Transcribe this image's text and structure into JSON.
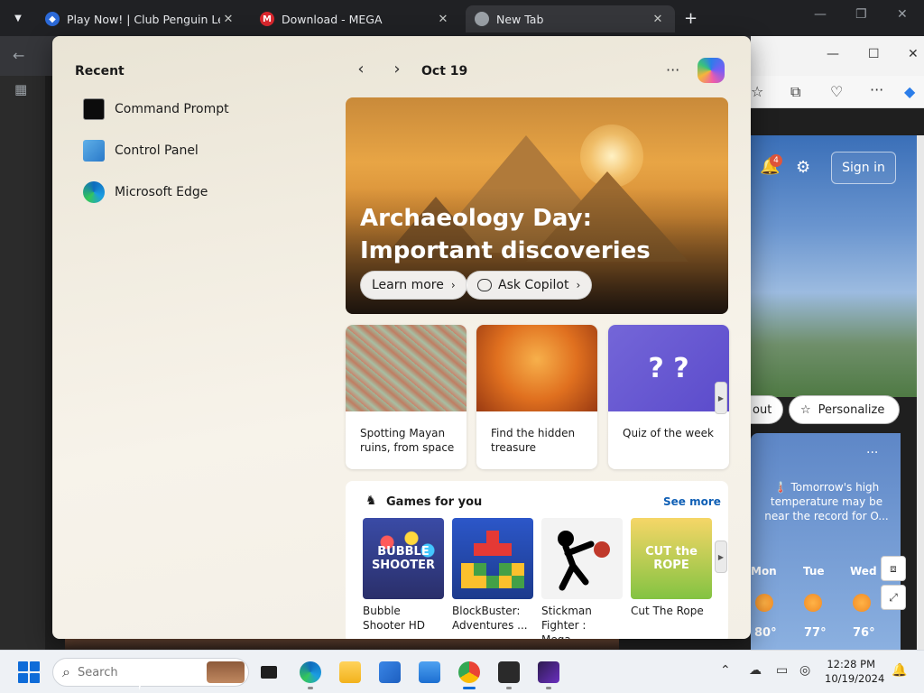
{
  "browser": {
    "tabs": [
      {
        "title": "Play Now! | Club Penguin Legac",
        "close": "✕"
      },
      {
        "title": "Download - MEGA",
        "close": "✕",
        "favicon_letter": "M"
      },
      {
        "title": "New Tab",
        "close": "✕"
      }
    ],
    "new_tab": "+",
    "window_controls": {
      "minimize": "—",
      "maximize": "❐",
      "close": "✕"
    }
  },
  "background_page": {
    "notification_count": "4",
    "sign_in_label": "Sign in",
    "chip_partial": "out",
    "personalize_label": "Personalize",
    "weather": {
      "more": "···",
      "headline": "🌡️ Tomorrow's high temperature may be near the record for O...",
      "days": [
        {
          "day": "Mon",
          "temp": "80°"
        },
        {
          "day": "Tue",
          "temp": "77°"
        },
        {
          "day": "Wed",
          "temp": "76°"
        }
      ]
    }
  },
  "flyout": {
    "recent_label": "Recent",
    "recent_items": [
      {
        "label": "Command Prompt"
      },
      {
        "label": "Control Panel"
      },
      {
        "label": "Microsoft Edge"
      }
    ],
    "date": "Oct 19",
    "more": "···",
    "hero": {
      "title": "Archaeology Day: Important discoveries",
      "learn_more": "Learn more",
      "ask_copilot": "Ask Copilot"
    },
    "cards": [
      {
        "caption": "Spotting Mayan ruins, from space"
      },
      {
        "caption": "Find the hidden treasure"
      },
      {
        "caption": "Quiz of the week",
        "art": "? ?"
      }
    ],
    "games": {
      "title": "Games for you",
      "see_more": "See more",
      "items": [
        {
          "name": "Bubble Shooter HD",
          "art": "BUBBLE SHOOTER"
        },
        {
          "name": "BlockBuster: Adventures ...",
          "art": ""
        },
        {
          "name": "Stickman Fighter : Mega...",
          "art": ""
        },
        {
          "name": "Cut The Rope",
          "art": "CUT the ROPE"
        }
      ]
    }
  },
  "taskbar": {
    "search_placeholder": "Search",
    "time": "12:28 PM",
    "date": "10/19/2024"
  },
  "colors": {
    "accent": "#0f6cd8",
    "link": "#0f5fb5",
    "tabstrip": "#202124"
  }
}
